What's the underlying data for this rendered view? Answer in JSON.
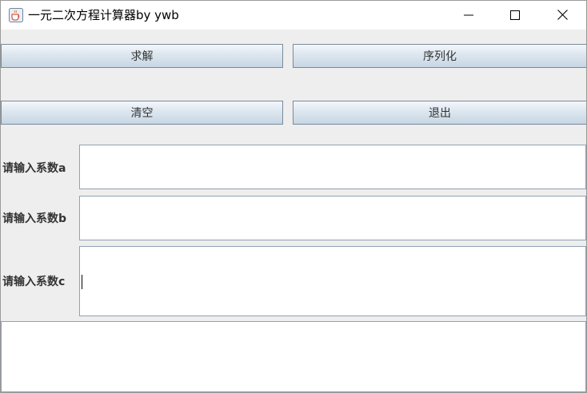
{
  "window": {
    "title": "一元二次方程计算器by ywb",
    "icon": "java-cup-icon"
  },
  "titlebar_controls": {
    "minimize_icon": "minimize-icon",
    "maximize_icon": "maximize-icon",
    "close_icon": "close-icon"
  },
  "buttons": {
    "solve": "求解",
    "serialize": "序列化",
    "clear": "清空",
    "exit": "退出"
  },
  "inputs": {
    "a": {
      "label": "请输入系数a",
      "value": ""
    },
    "b": {
      "label": "请输入系数b",
      "value": ""
    },
    "c": {
      "label": "请输入系数c",
      "value": ""
    }
  },
  "output": {
    "value": ""
  },
  "colors": {
    "panel_bg": "#eeeeee",
    "button_border": "#7a8a99",
    "field_border": "#8fa1b3"
  }
}
